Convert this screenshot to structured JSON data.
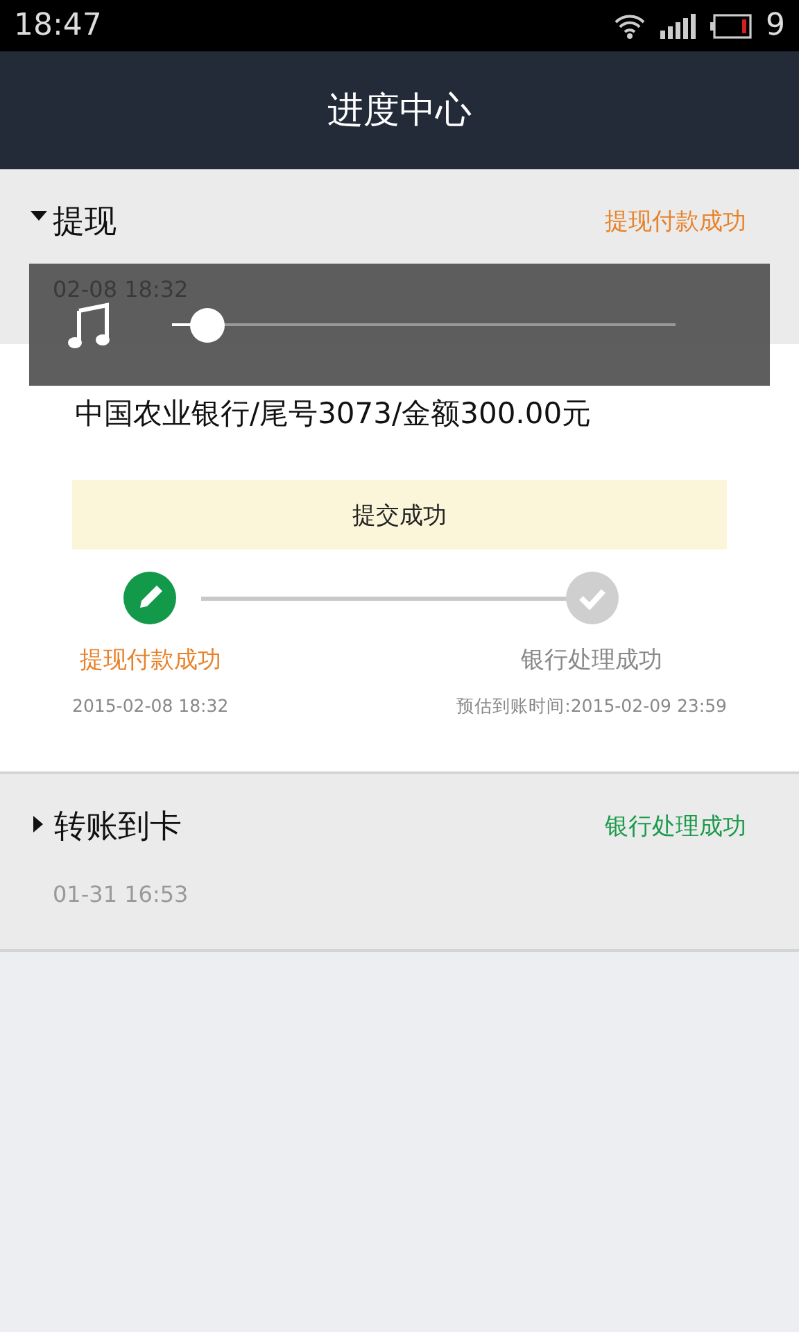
{
  "status_bar": {
    "time": "18:47",
    "battery": "9"
  },
  "header": {
    "title": "进度中心"
  },
  "records": [
    {
      "title": "提现",
      "status": "提现付款成功",
      "color": "#e8822a",
      "expanded": true,
      "date": "02-08 18:32",
      "detail": {
        "account": "中国农业银行/尾号3073/金额300.00元",
        "notice": "提交成功",
        "steps": [
          {
            "label": "提现付款成功",
            "time": "2015-02-08 18:32",
            "completed": true
          },
          {
            "label": "银行处理成功",
            "time": "预估到账时间:2015-02-09 23:59",
            "completed": false
          }
        ]
      }
    },
    {
      "title": "转账到卡",
      "status": "银行处理成功",
      "color": "#1a9a4a",
      "expanded": false,
      "date": "01-31 16:53"
    }
  ],
  "media_overlay": {
    "level": 0.05
  }
}
